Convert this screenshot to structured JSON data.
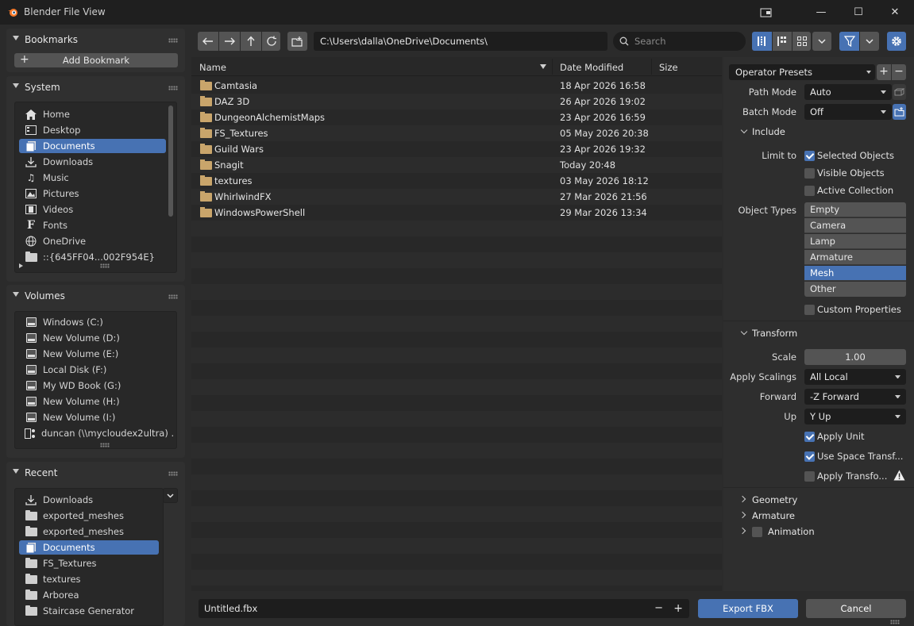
{
  "window": {
    "title": "Blender File View",
    "minimize": "—",
    "maximize": "☐",
    "close": "✕"
  },
  "bookmarks": {
    "title": "Bookmarks",
    "add_label": "Add Bookmark"
  },
  "system": {
    "title": "System",
    "items": [
      {
        "label": "Home",
        "icon": "home-icon"
      },
      {
        "label": "Desktop",
        "icon": "desktop-icon"
      },
      {
        "label": "Documents",
        "icon": "documents-icon",
        "selected": true
      },
      {
        "label": "Downloads",
        "icon": "download-icon"
      },
      {
        "label": "Music",
        "icon": "music-icon"
      },
      {
        "label": "Pictures",
        "icon": "pictures-icon"
      },
      {
        "label": "Videos",
        "icon": "videos-icon"
      },
      {
        "label": "Fonts",
        "icon": "font-icon"
      },
      {
        "label": "OneDrive",
        "icon": "globe-icon"
      },
      {
        "label": "::{645FF04...002F954E}",
        "icon": "folder-icon"
      }
    ]
  },
  "volumes": {
    "title": "Volumes",
    "items": [
      {
        "label": "Windows (C:)"
      },
      {
        "label": "New Volume (D:)"
      },
      {
        "label": "New Volume (E:)"
      },
      {
        "label": "Local Disk (F:)"
      },
      {
        "label": "My WD Book (G:)"
      },
      {
        "label": "New Volume (H:)"
      },
      {
        "label": "New Volume (I:)"
      },
      {
        "label": "duncan (\\\\mycloudex2ultra) ..."
      }
    ]
  },
  "recent": {
    "title": "Recent",
    "items": [
      {
        "label": "Downloads"
      },
      {
        "label": "exported_meshes"
      },
      {
        "label": "exported_meshes"
      },
      {
        "label": "Documents",
        "selected": true
      },
      {
        "label": "FS_Textures"
      },
      {
        "label": "textures"
      },
      {
        "label": "Arborea"
      },
      {
        "label": "Staircase Generator"
      }
    ]
  },
  "toolbar": {
    "path": "C:\\Users\\dalla\\OneDrive\\Documents\\",
    "search_placeholder": "Search"
  },
  "filelist": {
    "columns": {
      "name": "Name",
      "date": "Date Modified",
      "size": "Size"
    },
    "rows": [
      {
        "name": "Camtasia",
        "date": "18 Apr 2026 16:58"
      },
      {
        "name": "DAZ 3D",
        "date": "26 Apr 2026 19:02"
      },
      {
        "name": "DungeonAlchemistMaps",
        "date": "23 Apr 2026 16:59"
      },
      {
        "name": "FS_Textures",
        "date": "05 May 2026 20:38"
      },
      {
        "name": "Guild Wars",
        "date": "23 Apr 2026 19:32"
      },
      {
        "name": "Snagit",
        "date": "Today 20:48"
      },
      {
        "name": "textures",
        "date": "03 May 2026 18:12"
      },
      {
        "name": "WhirlwindFX",
        "date": "27 Mar 2026 21:56"
      },
      {
        "name": "WindowsPowerShell",
        "date": "29 Mar 2026 13:34"
      }
    ]
  },
  "bottom": {
    "filename": "Untitled.fbx",
    "export_label": "Export FBX",
    "cancel_label": "Cancel",
    "minus": "−",
    "plus": "+"
  },
  "panel": {
    "presets": "Operator Presets",
    "path_mode_label": "Path Mode",
    "path_mode_value": "Auto",
    "batch_mode_label": "Batch Mode",
    "batch_mode_value": "Off",
    "include_title": "Include",
    "limit_to_label": "Limit to",
    "selected_objects": "Selected Objects",
    "visible_objects": "Visible Objects",
    "active_collection": "Active Collection",
    "object_types_label": "Object Types",
    "object_types": [
      {
        "label": "Empty"
      },
      {
        "label": "Camera"
      },
      {
        "label": "Lamp"
      },
      {
        "label": "Armature"
      },
      {
        "label": "Mesh",
        "selected": true
      },
      {
        "label": "Other"
      }
    ],
    "custom_properties": "Custom Properties",
    "transform_title": "Transform",
    "scale_label": "Scale",
    "scale_value": "1.00",
    "apply_scalings_label": "Apply Scalings",
    "apply_scalings_value": "All Local",
    "forward_label": "Forward",
    "forward_value": "-Z Forward",
    "up_label": "Up",
    "up_value": "Y Up",
    "apply_unit": "Apply Unit",
    "use_space_transform": "Use Space Transf...",
    "apply_transform": "Apply Transfo...",
    "geometry_title": "Geometry",
    "armature_title": "Armature",
    "animation_title": "Animation"
  },
  "colors": {
    "accent": "#4772b3",
    "folder": "#c9a56b",
    "background": "#2b2b2b"
  }
}
